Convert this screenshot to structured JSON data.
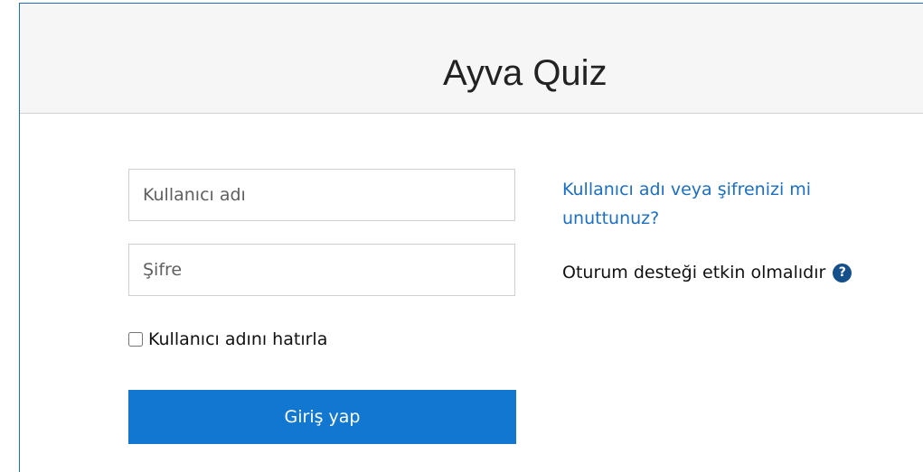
{
  "header": {
    "site_title": "Ayva Quiz"
  },
  "login_form": {
    "username_placeholder": "Kullanıcı adı",
    "password_placeholder": "Şifre",
    "remember_label": "Kullanıcı adını hatırla",
    "remember_checked": false,
    "submit_label": "Giriş yap"
  },
  "side_info": {
    "forgot_link": "Kullanıcı adı veya şifrenizi mi unuttunuz?",
    "cookies_notice": "Oturum desteği etkin olmalıdır",
    "help_icon_glyph": "?"
  },
  "colors": {
    "primary": "#1177d1",
    "link": "#1a6fc4",
    "help_icon": "#15508a",
    "header_bg": "#f6f6f6"
  }
}
